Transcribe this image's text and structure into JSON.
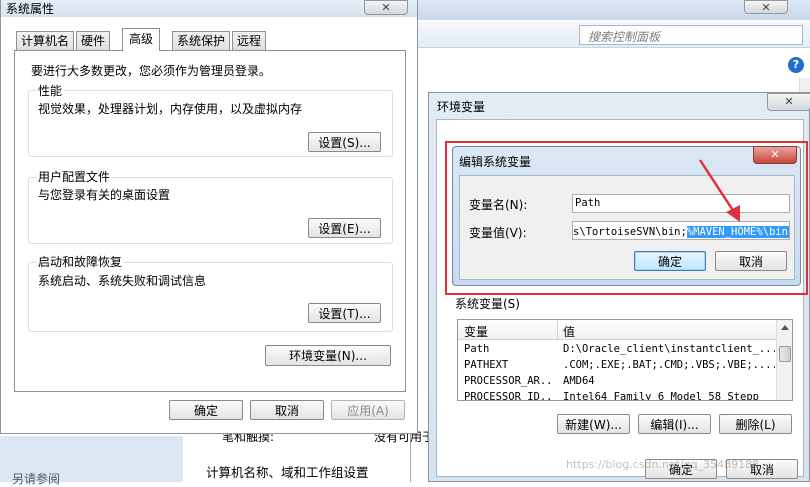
{
  "background_window": {
    "search_placeholder": "搜索控制面板",
    "help_glyph": "?",
    "left_text": "另请参阅",
    "line1_label": "笔和触摸:",
    "line1_value": "没有可用于",
    "section_title": "计算机名称、域和工作组设置"
  },
  "system_properties": {
    "title": "系统属性",
    "close_glyph": "✕",
    "tabs": [
      "计算机名",
      "硬件",
      "高级",
      "系统保护",
      "远程"
    ],
    "active_tab": 2,
    "admin_note": "要进行大多数更改，您必须作为管理员登录。",
    "groups": [
      {
        "title": "性能",
        "desc": "视觉效果，处理器计划，内存使用，以及虚拟内存",
        "button": "设置(S)..."
      },
      {
        "title": "用户配置文件",
        "desc": "与您登录有关的桌面设置",
        "button": "设置(E)..."
      },
      {
        "title": "启动和故障恢复",
        "desc": "系统启动、系统失败和调试信息",
        "button": "设置(T)..."
      }
    ],
    "env_button": "环境变量(N)...",
    "ok": "确定",
    "cancel": "取消",
    "apply": "应用(A)"
  },
  "env_vars": {
    "title": "环境变量",
    "close_glyph": "✕",
    "system_vars_label": "系统变量(S)",
    "col_var": "变量",
    "col_val": "值",
    "rows": [
      {
        "name": "Path",
        "value": "D:\\Oracle_client\\instantclient_..."
      },
      {
        "name": "PATHEXT",
        "value": ".COM;.EXE;.BAT;.CMD;.VBS;.VBE;...."
      },
      {
        "name": "PROCESSOR_AR...",
        "value": "AMD64"
      },
      {
        "name": "PROCESSOR_ID...",
        "value": "Intel64 Family 6 Model 58 Stepp"
      }
    ],
    "new_btn": "新建(W)...",
    "edit_btn": "编辑(I)...",
    "delete_btn": "删除(L)",
    "ok": "确定",
    "cancel": "取消"
  },
  "edit_dialog": {
    "title": "编辑系统变量",
    "close_glyph": "✕",
    "name_label": "变量名(N):",
    "name_value": "Path",
    "value_label": "变量值(V):",
    "value_prefix": "s\\TortoiseSVN\\bin;",
    "value_selected": "%MAVEN_HOME%\\bin;",
    "ok": "确定",
    "cancel": "取消"
  },
  "watermark": "https://blog.csdn.net/qq_35489188",
  "colors": {
    "highlight_box": "#e0303a",
    "arrow": "#e0303a",
    "selection": "#3399ff",
    "dialog_frame": "#bcd3ea"
  }
}
